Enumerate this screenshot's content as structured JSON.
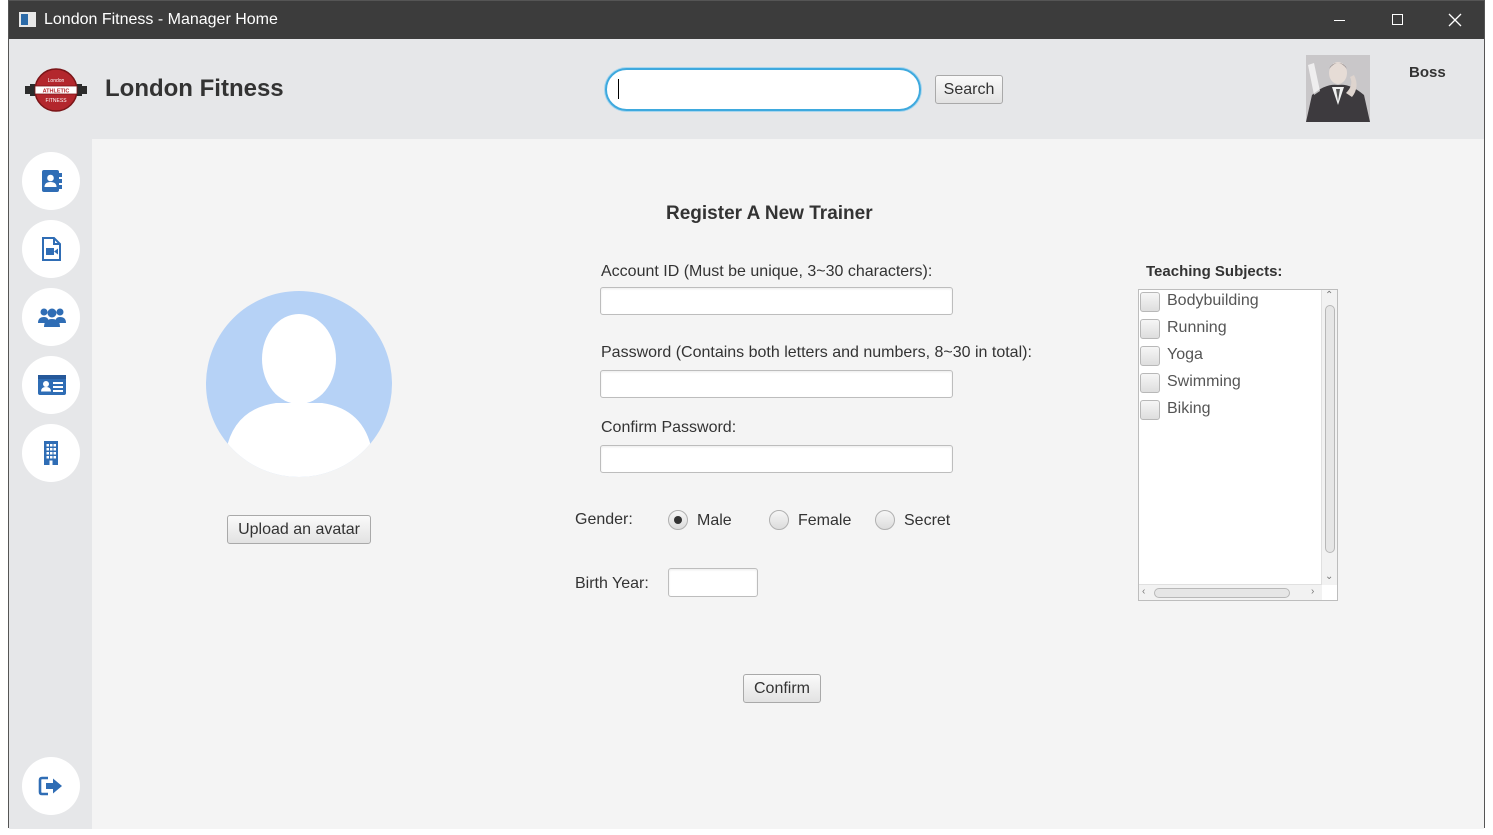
{
  "window": {
    "title": "London Fitness - Manager Home"
  },
  "header": {
    "brand": "London Fitness",
    "logo_text_top": "London",
    "logo_text_band": "ATHLETIC",
    "logo_text_bottom": "FITNESS",
    "search": {
      "value": "",
      "placeholder": ""
    },
    "search_button": "Search",
    "user_name": "Boss"
  },
  "sidebar": {
    "items": [
      {
        "icon": "address-book-icon"
      },
      {
        "icon": "video-file-icon"
      },
      {
        "icon": "users-icon"
      },
      {
        "icon": "id-card-icon"
      },
      {
        "icon": "building-icon"
      }
    ],
    "logout_icon": "sign-out-icon"
  },
  "form": {
    "title": "Register A New Trainer",
    "upload_button": "Upload an avatar",
    "account_label": "Account ID (Must be unique, 3~30 characters):",
    "password_label": "Password  (Contains both letters and numbers, 8~30 in total):",
    "confirm_password_label": "Confirm Password:",
    "gender_label": "Gender:",
    "gender_options": [
      "Male",
      "Female",
      "Secret"
    ],
    "gender_selected": "Male",
    "birth_year_label": "Birth Year:",
    "confirm_button": "Confirm",
    "subjects_title": "Teaching Subjects:",
    "subjects": [
      "Bodybuilding",
      "Running",
      "Yoga",
      "Swimming",
      "Biking"
    ]
  },
  "colors": {
    "titlebar": "#3c3c3c",
    "header_bg": "#e6e7e9",
    "main_bg": "#f4f4f4",
    "accent_icon": "#2f6db5",
    "focus_ring": "#3ea9de",
    "avatar_placeholder": "#b6d2f6",
    "logo_red": "#b3272d"
  }
}
